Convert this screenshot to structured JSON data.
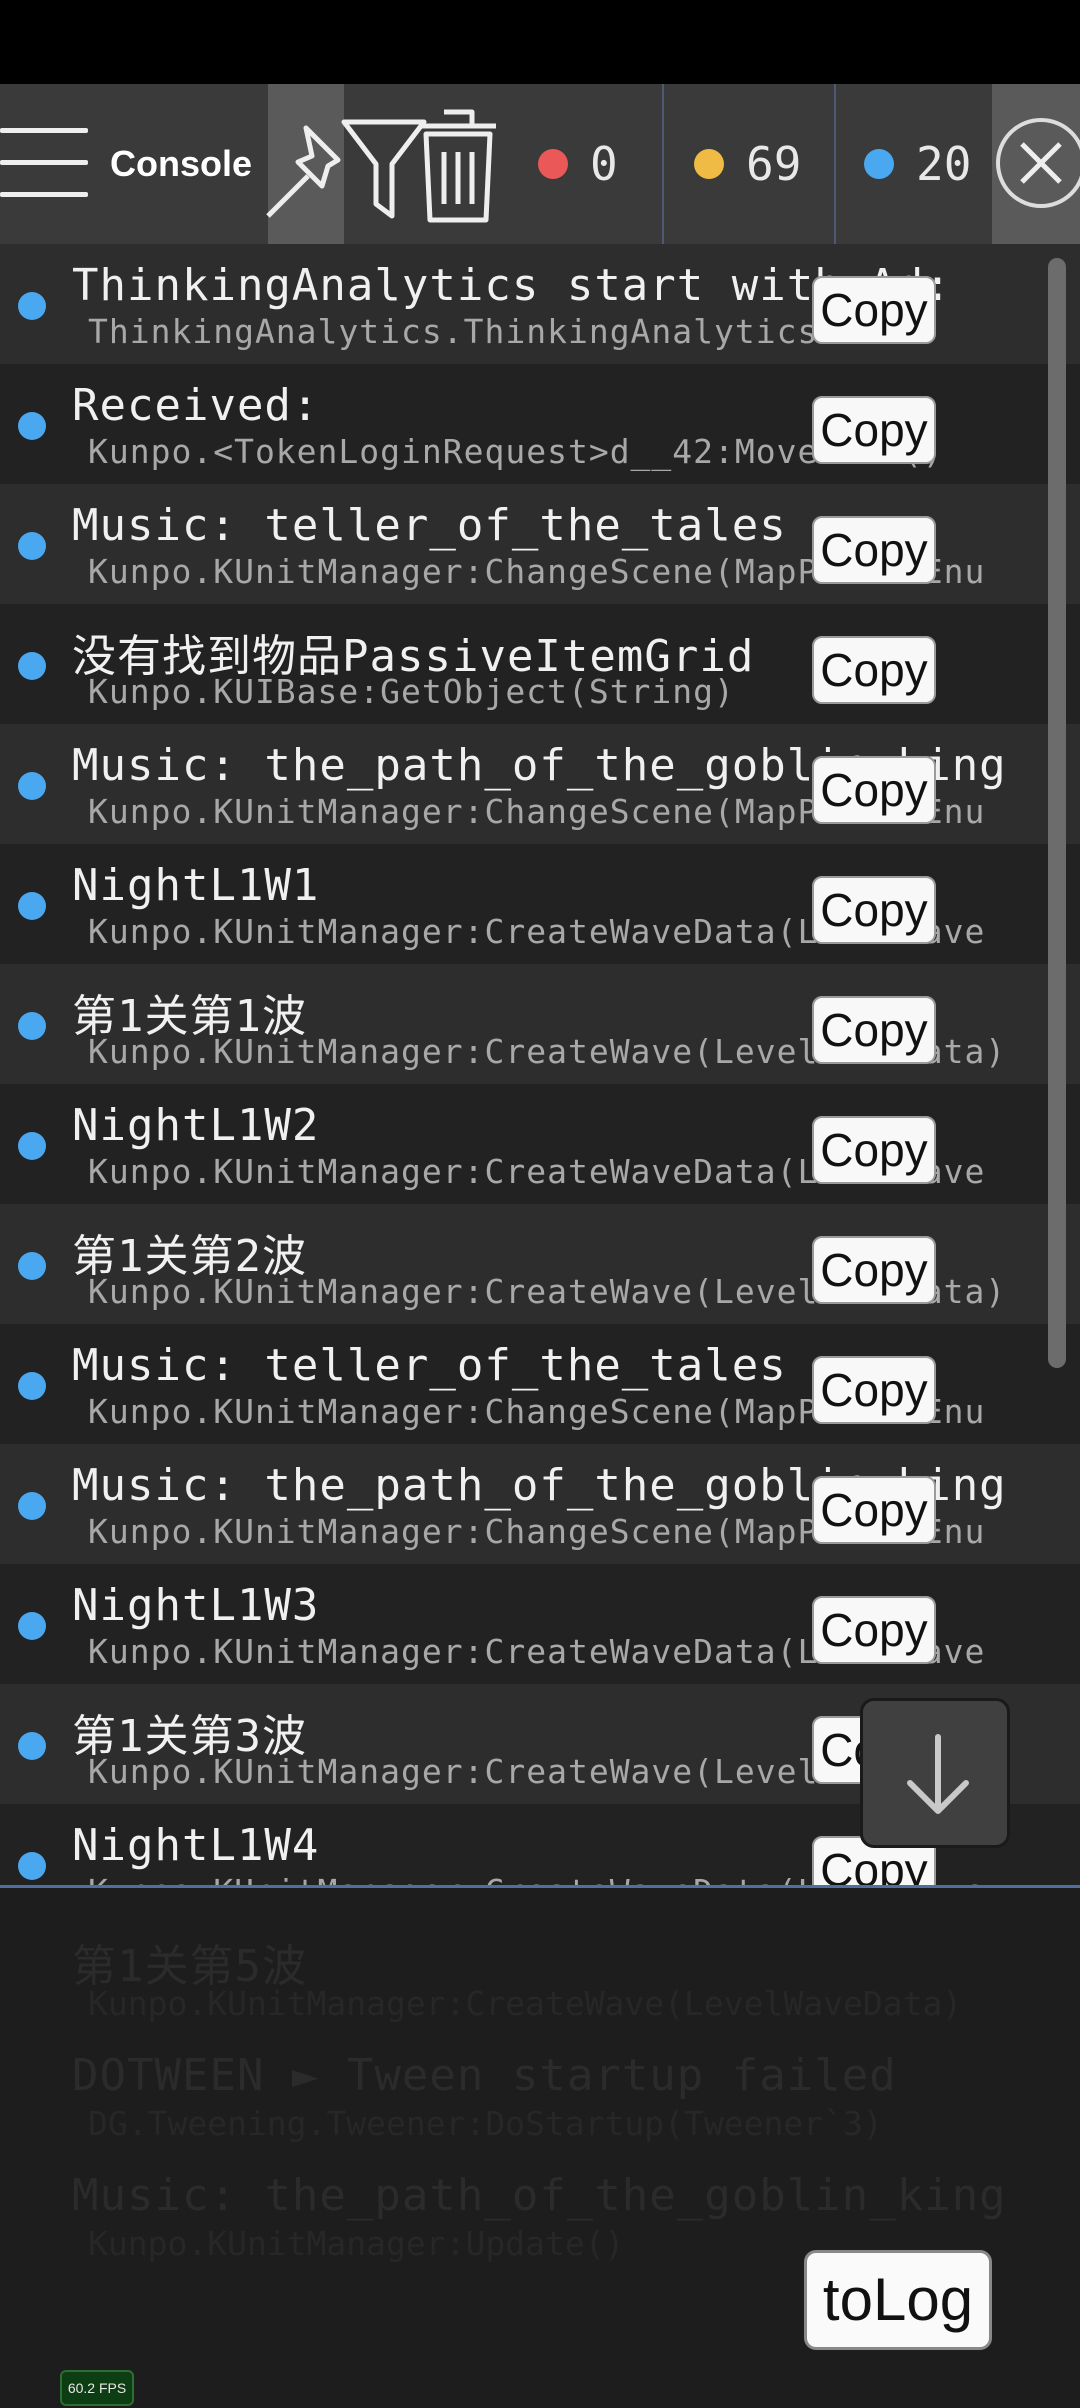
{
  "toolbar": {
    "title": "Console",
    "error_count": "0",
    "warning_count": "69",
    "info_count": "20"
  },
  "colors": {
    "error": "#ea5858",
    "warning": "#f0bb45",
    "info": "#4aa8f0"
  },
  "icons": {
    "menu": "hamburger-icon",
    "pin": "pin-icon",
    "filter": "funnel-icon",
    "clear": "trash-icon",
    "close": "close-icon",
    "scroll": "arrow-down-icon"
  },
  "logs": [
    {
      "message": "ThinkingAnalytics start with Ad:",
      "trace": "ThinkingAnalytics.ThinkingAnalytics:Star",
      "copy": "Copy"
    },
    {
      "message": "Received:",
      "trace": "Kunpo.<TokenLoginRequest>d__42:MoveNext()",
      "copy": "Copy"
    },
    {
      "message": "Music: teller_of_the_tales",
      "trace": "Kunpo.KUnitManager:ChangeScene(MapPrefabEnu",
      "copy": "Copy"
    },
    {
      "message": "没有找到物品PassiveItemGrid",
      "trace": "Kunpo.KUIBase:GetObject(String)",
      "copy": "Copy"
    },
    {
      "message": "Music: the_path_of_the_goblin_king",
      "trace": "Kunpo.KUnitManager:ChangeScene(MapPrefabEnu",
      "copy": "Copy"
    },
    {
      "message": "NightL1W1",
      "trace": "Kunpo.KUnitManager:CreateWaveData(LevelSave",
      "copy": "Copy"
    },
    {
      "message": "第1关第1波",
      "trace": "Kunpo.KUnitManager:CreateWave(LevelWaveData)",
      "copy": "Copy"
    },
    {
      "message": "NightL1W2",
      "trace": "Kunpo.KUnitManager:CreateWaveData(LevelSave",
      "copy": "Copy"
    },
    {
      "message": "第1关第2波",
      "trace": "Kunpo.KUnitManager:CreateWave(LevelWaveData)",
      "copy": "Copy"
    },
    {
      "message": "Music: teller_of_the_tales",
      "trace": "Kunpo.KUnitManager:ChangeScene(MapPrefabEnu",
      "copy": "Copy"
    },
    {
      "message": "Music: the_path_of_the_goblin_king",
      "trace": "Kunpo.KUnitManager:ChangeScene(MapPrefabEnu",
      "copy": "Copy"
    },
    {
      "message": "NightL1W3",
      "trace": "Kunpo.KUnitManager:CreateWaveData(LevelSave",
      "copy": "Copy"
    },
    {
      "message": "第1关第3波",
      "trace": "Kunpo.KUnitManager:CreateWave(LevelWaveData)",
      "copy": "Copy"
    },
    {
      "message": "NightL1W4",
      "trace": "Kunpo.KUnitManager:CreateWaveData(LevelSave",
      "copy": "Copy"
    }
  ],
  "background_logs": [
    {
      "message": "第1关第5波",
      "trace": "Kunpo.KUnitManager:CreateWave(LevelWaveData)"
    },
    {
      "message": "DOTWEEN ► Tween startup failed",
      "trace": "DG.Tweening.Tweener:DoStartup(Tweener`3)"
    },
    {
      "message": "Music: the_path_of_the_goblin_king",
      "trace": "Kunpo.KUnitManager:Update()"
    }
  ],
  "tolog_label": "toLog",
  "fps_label": "60.2 FPS"
}
